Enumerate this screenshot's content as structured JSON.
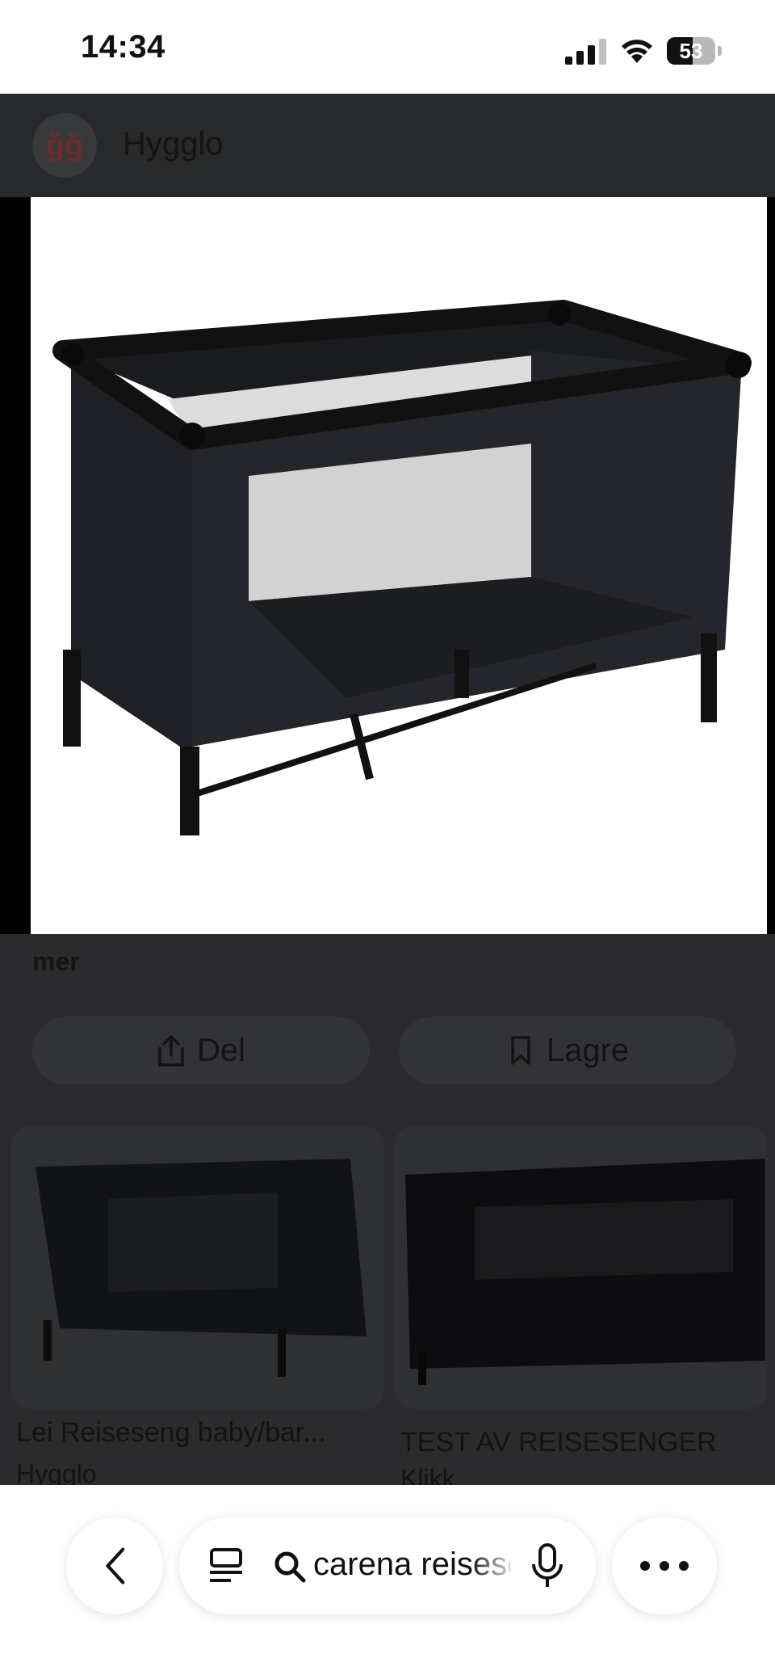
{
  "status_bar": {
    "time": "14:34",
    "battery_level": "53"
  },
  "site": {
    "logo_text": "ğğ",
    "name": "Hygglo"
  },
  "result": {
    "description_tail": "mer"
  },
  "actions": {
    "share_label": "Del",
    "save_label": "Lagre"
  },
  "related": [
    {
      "title": "Lei Reiseseng baby/bar...",
      "source": "Hygglo"
    },
    {
      "title": "TEST AV REISESENGER",
      "source": "Klikk"
    }
  ],
  "bottom_nav": {
    "query": "carena reiseseng"
  },
  "colors": {
    "overlay": "#2b2b2d",
    "bar": "#ffffff",
    "text": "#111111"
  }
}
